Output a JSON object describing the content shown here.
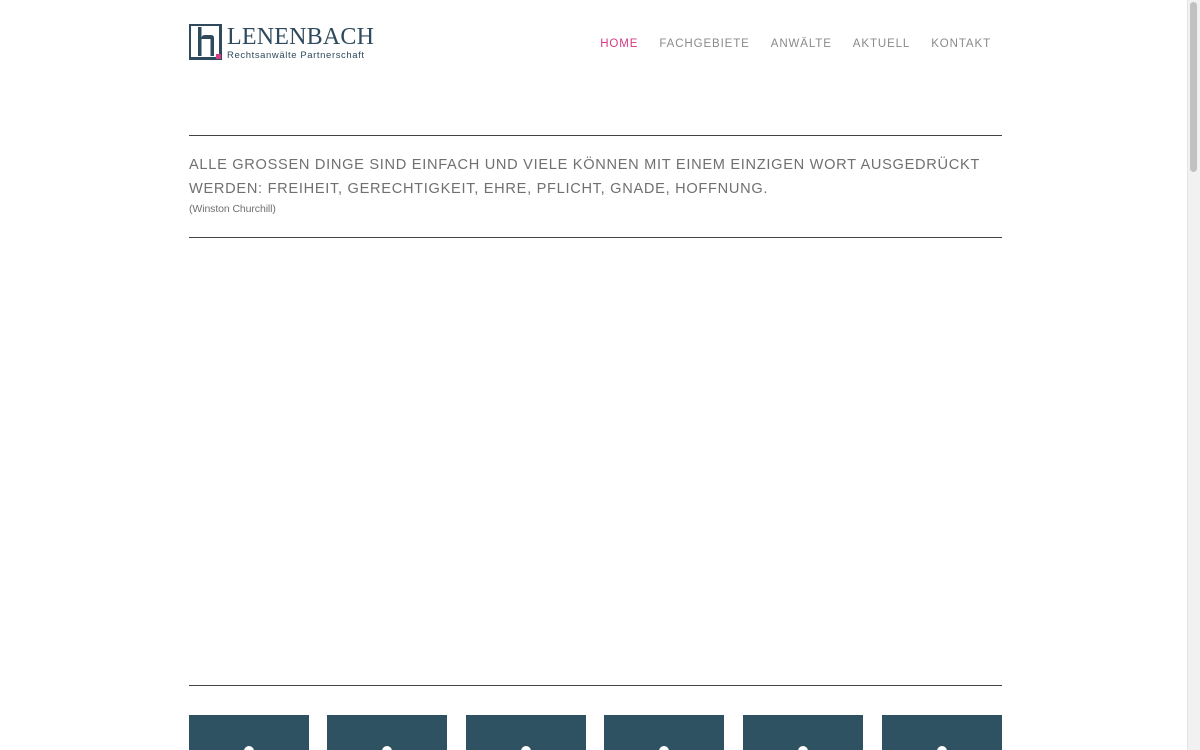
{
  "brand": {
    "name": "LENENBACH",
    "subtitle": "Rechtsanwälte Partnerschaft",
    "logo_icon": "lh-monogram-icon",
    "primary_color": "#2e4a5c",
    "accent_color": "#d63a86"
  },
  "nav": {
    "items": [
      {
        "label": "HOME",
        "active": true
      },
      {
        "label": "FACHGEBIETE",
        "active": false
      },
      {
        "label": "ANWÄLTE",
        "active": false
      },
      {
        "label": "AKTUELL",
        "active": false
      },
      {
        "label": "KONTAKT",
        "active": false
      }
    ]
  },
  "quote": {
    "text": "ALLE GROSSEN DINGE SIND EINFACH UND VIELE KÖNNEN MIT EINEM EINZIGEN WORT AUSGEDRÜCKT WERDEN: FREIHEIT, GERECHTIGKEIT, EHRE, PFLICHT, GNADE, HOFFNUNG.",
    "author": "(Winston Churchill)"
  },
  "tiles": {
    "count": 6,
    "color": "#2e5261"
  }
}
